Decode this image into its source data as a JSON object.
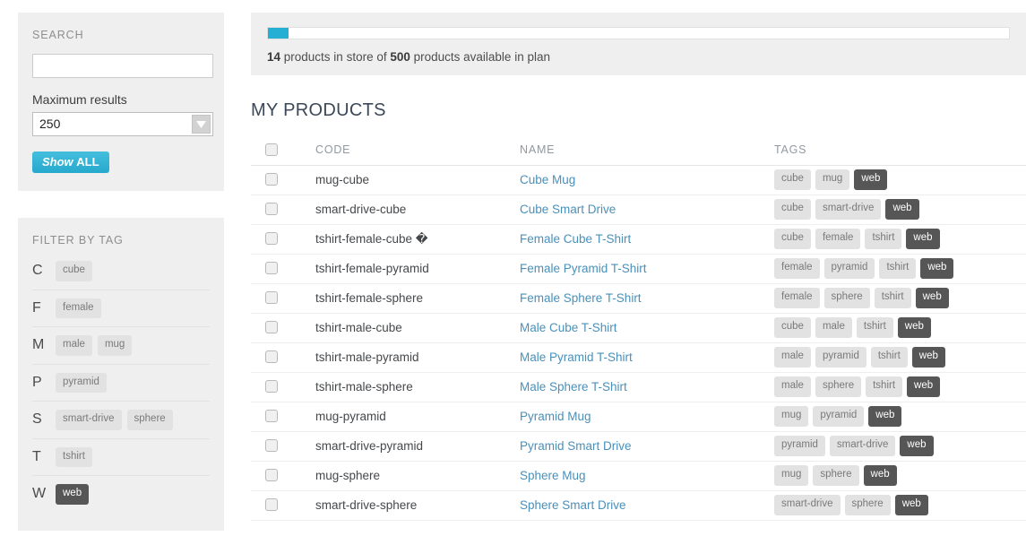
{
  "sidebar": {
    "search_panel": {
      "title": "SEARCH",
      "search_value": "",
      "search_placeholder": "",
      "max_results_label": "Maximum results",
      "max_results_value": "250",
      "show_all_em": "Show",
      "show_all_strong": "ALL"
    },
    "filter_panel": {
      "title": "FILTER BY TAG",
      "groups": [
        {
          "letter": "C",
          "tags": [
            {
              "label": "cube",
              "active": false
            }
          ]
        },
        {
          "letter": "F",
          "tags": [
            {
              "label": "female",
              "active": false
            }
          ]
        },
        {
          "letter": "M",
          "tags": [
            {
              "label": "male",
              "active": false
            },
            {
              "label": "mug",
              "active": false
            }
          ]
        },
        {
          "letter": "P",
          "tags": [
            {
              "label": "pyramid",
              "active": false
            }
          ]
        },
        {
          "letter": "S",
          "tags": [
            {
              "label": "smart-drive",
              "active": false
            },
            {
              "label": "sphere",
              "active": false
            }
          ]
        },
        {
          "letter": "T",
          "tags": [
            {
              "label": "tshirt",
              "active": false
            }
          ]
        },
        {
          "letter": "W",
          "tags": [
            {
              "label": "web",
              "active": true
            }
          ]
        }
      ]
    }
  },
  "status": {
    "count": "14",
    "text_mid": " products in store of ",
    "limit": "500",
    "text_end": " products available in plan",
    "progress_percent": 2.8,
    "progress_color": "#26afd4"
  },
  "main": {
    "section_title": "MY PRODUCTS",
    "columns": {
      "code": "CODE",
      "name": "NAME",
      "tags": "TAGS"
    },
    "rows": [
      {
        "code": "mug-cube",
        "name": "Cube Mug",
        "tags": [
          {
            "label": "cube",
            "active": false
          },
          {
            "label": "mug",
            "active": false
          },
          {
            "label": "web",
            "active": true
          }
        ]
      },
      {
        "code": "smart-drive-cube",
        "name": "Cube Smart Drive",
        "tags": [
          {
            "label": "cube",
            "active": false
          },
          {
            "label": "smart-drive",
            "active": false
          },
          {
            "label": "web",
            "active": true
          }
        ]
      },
      {
        "code": "tshirt-female-cube �",
        "name": "Female Cube T-Shirt",
        "tags": [
          {
            "label": "cube",
            "active": false
          },
          {
            "label": "female",
            "active": false
          },
          {
            "label": "tshirt",
            "active": false
          },
          {
            "label": "web",
            "active": true
          }
        ]
      },
      {
        "code": "tshirt-female-pyramid",
        "name": "Female Pyramid T-Shirt",
        "tags": [
          {
            "label": "female",
            "active": false
          },
          {
            "label": "pyramid",
            "active": false
          },
          {
            "label": "tshirt",
            "active": false
          },
          {
            "label": "web",
            "active": true
          }
        ]
      },
      {
        "code": "tshirt-female-sphere",
        "name": "Female Sphere T-Shirt",
        "tags": [
          {
            "label": "female",
            "active": false
          },
          {
            "label": "sphere",
            "active": false
          },
          {
            "label": "tshirt",
            "active": false
          },
          {
            "label": "web",
            "active": true
          }
        ]
      },
      {
        "code": "tshirt-male-cube",
        "name": "Male Cube T-Shirt",
        "tags": [
          {
            "label": "cube",
            "active": false
          },
          {
            "label": "male",
            "active": false
          },
          {
            "label": "tshirt",
            "active": false
          },
          {
            "label": "web",
            "active": true
          }
        ]
      },
      {
        "code": "tshirt-male-pyramid",
        "name": "Male Pyramid T-Shirt",
        "tags": [
          {
            "label": "male",
            "active": false
          },
          {
            "label": "pyramid",
            "active": false
          },
          {
            "label": "tshirt",
            "active": false
          },
          {
            "label": "web",
            "active": true
          }
        ]
      },
      {
        "code": "tshirt-male-sphere",
        "name": "Male Sphere T-Shirt",
        "tags": [
          {
            "label": "male",
            "active": false
          },
          {
            "label": "sphere",
            "active": false
          },
          {
            "label": "tshirt",
            "active": false
          },
          {
            "label": "web",
            "active": true
          }
        ]
      },
      {
        "code": "mug-pyramid",
        "name": "Pyramid Mug",
        "tags": [
          {
            "label": "mug",
            "active": false
          },
          {
            "label": "pyramid",
            "active": false
          },
          {
            "label": "web",
            "active": true
          }
        ]
      },
      {
        "code": "smart-drive-pyramid",
        "name": "Pyramid Smart Drive",
        "tags": [
          {
            "label": "pyramid",
            "active": false
          },
          {
            "label": "smart-drive",
            "active": false
          },
          {
            "label": "web",
            "active": true
          }
        ]
      },
      {
        "code": "mug-sphere",
        "name": "Sphere Mug",
        "tags": [
          {
            "label": "mug",
            "active": false
          },
          {
            "label": "sphere",
            "active": false
          },
          {
            "label": "web",
            "active": true
          }
        ]
      },
      {
        "code": "smart-drive-sphere",
        "name": "Sphere Smart Drive",
        "tags": [
          {
            "label": "smart-drive",
            "active": false
          },
          {
            "label": "sphere",
            "active": false
          },
          {
            "label": "web",
            "active": true
          }
        ]
      }
    ]
  },
  "colors": {
    "accent": "#26afd4",
    "panel_bg": "#efefef",
    "link": "#4a90b9",
    "tag_bg": "#e2e2e2",
    "tag_active_bg": "#565656"
  }
}
